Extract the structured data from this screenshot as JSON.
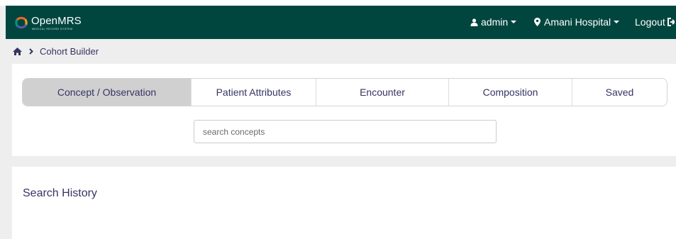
{
  "header": {
    "app_name": "OpenMRS",
    "tagline": "Medical Record System",
    "user_label": "admin",
    "location_label": "Amani Hospital",
    "logout_label": "Logout",
    "colors": {
      "background": "#00463f",
      "text": "#ffffff"
    }
  },
  "breadcrumb": {
    "home_icon": "home-icon",
    "separator_icon": "chevron-right-icon",
    "current": "Cohort Builder"
  },
  "tabs": [
    {
      "label": "Concept / Observation",
      "active": true
    },
    {
      "label": "Patient Attributes",
      "active": false
    },
    {
      "label": "Encounter",
      "active": false
    },
    {
      "label": "Composition",
      "active": false
    },
    {
      "label": "Saved",
      "active": false
    }
  ],
  "search": {
    "placeholder": "search concepts",
    "value": ""
  },
  "history": {
    "title": "Search History"
  }
}
